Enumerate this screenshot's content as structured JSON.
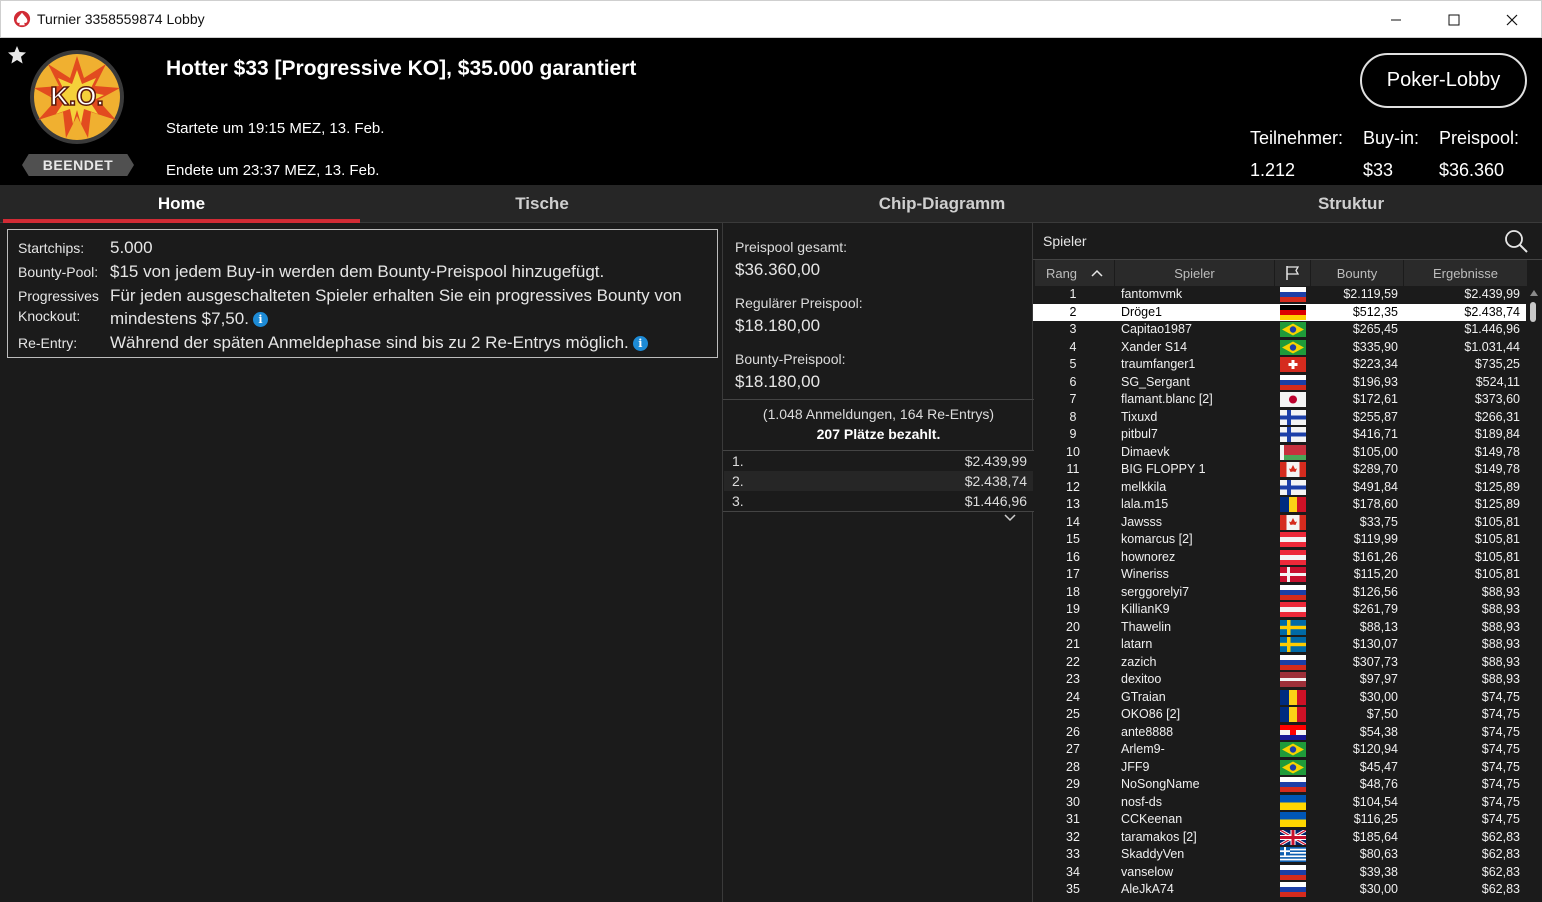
{
  "window": {
    "title": "Turnier 3358559874 Lobby"
  },
  "header": {
    "logo_text": "K.O.",
    "status": "BEENDET",
    "title": "Hotter $33 [Progressive KO], $35.000 garantiert",
    "started": "Startete um 19:15 MEZ, 13. Feb.",
    "ended": "Endete um 23:37 MEZ, 13. Feb.",
    "lobby_button": "Poker-Lobby",
    "stats": [
      {
        "label": "Teilnehmer:",
        "value": "1.212"
      },
      {
        "label": "Buy-in:",
        "value": "$33"
      },
      {
        "label": "Preispool:",
        "value": "$36.360"
      }
    ]
  },
  "tabs": [
    {
      "label": "Home",
      "active": true
    },
    {
      "label": "Tische",
      "active": false
    },
    {
      "label": "Chip-Diagramm",
      "active": false
    },
    {
      "label": "Struktur",
      "active": false
    }
  ],
  "info": {
    "startchips_label": "Startchips:",
    "startchips_value": "5.000",
    "bountypool_label": "Bounty-Pool:",
    "bountypool_value": "$15 von jedem Buy-in werden dem Bounty-Preispool hinzugefügt.",
    "progressive_label1": "Progressives",
    "progressive_label2": "Knockout:",
    "progressive_value1": "Für jeden ausgeschalteten Spieler erhalten Sie ein progressives Bounty von",
    "progressive_value2": "mindestens $7,50.",
    "reentry_label": "Re-Entry:",
    "reentry_value": "Während der späten Anmeldephase sind bis zu 2 Re-Entrys möglich.",
    "info_icon": "i"
  },
  "prizepool": {
    "total_label": "Preispool gesamt:",
    "total_value": "$36.360,00",
    "regular_label": "Regulärer Preispool:",
    "regular_value": "$18.180,00",
    "bounty_label": "Bounty-Preispool:",
    "bounty_value": "$18.180,00",
    "registrations": "(1.048 Anmeldungen, 164 Re-Entrys)",
    "paid": "207 Plätze bezahlt.",
    "places": [
      {
        "pos": "1.",
        "amount": "$2.439,99"
      },
      {
        "pos": "2.",
        "amount": "$2.438,74"
      },
      {
        "pos": "3.",
        "amount": "$1.446,96"
      }
    ]
  },
  "players": {
    "search_label": "Spieler",
    "columns": {
      "rank": "Rang",
      "player": "Spieler",
      "bounty": "Bounty",
      "result": "Ergebnisse"
    },
    "selected_index": 1,
    "rows": [
      {
        "rank": "1",
        "name": "fantomvmk",
        "flag": "ru",
        "bounty": "$2.119,59",
        "result": "$2.439,99"
      },
      {
        "rank": "2",
        "name": "Dröge1",
        "flag": "de",
        "bounty": "$512,35",
        "result": "$2.438,74"
      },
      {
        "rank": "3",
        "name": "Capitao1987",
        "flag": "br",
        "bounty": "$265,45",
        "result": "$1.446,96"
      },
      {
        "rank": "4",
        "name": "Xander S14",
        "flag": "br",
        "bounty": "$335,90",
        "result": "$1.031,44"
      },
      {
        "rank": "5",
        "name": "traumfanger1",
        "flag": "ch",
        "bounty": "$223,34",
        "result": "$735,25"
      },
      {
        "rank": "6",
        "name": "SG_Sergant",
        "flag": "ru",
        "bounty": "$196,93",
        "result": "$524,11"
      },
      {
        "rank": "7",
        "name": "flamant.blanc [2]",
        "flag": "jp",
        "bounty": "$172,61",
        "result": "$373,60"
      },
      {
        "rank": "8",
        "name": "Tixuxd",
        "flag": "fi",
        "bounty": "$255,87",
        "result": "$266,31"
      },
      {
        "rank": "9",
        "name": "pitbul7",
        "flag": "fi",
        "bounty": "$416,71",
        "result": "$189,84"
      },
      {
        "rank": "10",
        "name": "Dimaevk",
        "flag": "by",
        "bounty": "$105,00",
        "result": "$149,78"
      },
      {
        "rank": "11",
        "name": "BIG FLOPPY 1",
        "flag": "ca",
        "bounty": "$289,70",
        "result": "$149,78"
      },
      {
        "rank": "12",
        "name": "melkkila",
        "flag": "fi",
        "bounty": "$491,84",
        "result": "$125,89"
      },
      {
        "rank": "13",
        "name": "lala.m15",
        "flag": "ro",
        "bounty": "$178,60",
        "result": "$125,89"
      },
      {
        "rank": "14",
        "name": "Jawsss",
        "flag": "ca",
        "bounty": "$33,75",
        "result": "$105,81"
      },
      {
        "rank": "15",
        "name": "komarcus [2]",
        "flag": "at",
        "bounty": "$119,99",
        "result": "$105,81"
      },
      {
        "rank": "16",
        "name": "hownorez",
        "flag": "at",
        "bounty": "$161,26",
        "result": "$105,81"
      },
      {
        "rank": "17",
        "name": "Wineriss",
        "flag": "dk",
        "bounty": "$115,20",
        "result": "$105,81"
      },
      {
        "rank": "18",
        "name": "serggorelyi7",
        "flag": "ru",
        "bounty": "$126,56",
        "result": "$88,93"
      },
      {
        "rank": "19",
        "name": "KillianK9",
        "flag": "at",
        "bounty": "$261,79",
        "result": "$88,93"
      },
      {
        "rank": "20",
        "name": "Thawelin",
        "flag": "se",
        "bounty": "$88,13",
        "result": "$88,93"
      },
      {
        "rank": "21",
        "name": "latarn",
        "flag": "se",
        "bounty": "$130,07",
        "result": "$88,93"
      },
      {
        "rank": "22",
        "name": "zazich",
        "flag": "ru",
        "bounty": "$307,73",
        "result": "$88,93"
      },
      {
        "rank": "23",
        "name": "dexitoo",
        "flag": "lv",
        "bounty": "$97,97",
        "result": "$88,93"
      },
      {
        "rank": "24",
        "name": "GTraian",
        "flag": "ro",
        "bounty": "$30,00",
        "result": "$74,75"
      },
      {
        "rank": "25",
        "name": "OKO86 [2]",
        "flag": "ro",
        "bounty": "$7,50",
        "result": "$74,75"
      },
      {
        "rank": "26",
        "name": "ante8888",
        "flag": "hr",
        "bounty": "$54,38",
        "result": "$74,75"
      },
      {
        "rank": "27",
        "name": "Arlem9-",
        "flag": "br",
        "bounty": "$120,94",
        "result": "$74,75"
      },
      {
        "rank": "28",
        "name": "JFF9",
        "flag": "br",
        "bounty": "$45,47",
        "result": "$74,75"
      },
      {
        "rank": "29",
        "name": "NoSongName",
        "flag": "ru",
        "bounty": "$48,76",
        "result": "$74,75"
      },
      {
        "rank": "30",
        "name": "nosf-ds",
        "flag": "ua",
        "bounty": "$104,54",
        "result": "$74,75"
      },
      {
        "rank": "31",
        "name": "CCKeenan",
        "flag": "ua",
        "bounty": "$116,25",
        "result": "$74,75"
      },
      {
        "rank": "32",
        "name": "taramakos [2]",
        "flag": "gb",
        "bounty": "$185,64",
        "result": "$62,83"
      },
      {
        "rank": "33",
        "name": "SkaddyVen",
        "flag": "gr",
        "bounty": "$80,63",
        "result": "$62,83"
      },
      {
        "rank": "34",
        "name": "vanselow",
        "flag": "ru",
        "bounty": "$39,38",
        "result": "$62,83"
      },
      {
        "rank": "35",
        "name": "AleJkA74",
        "flag": "ru",
        "bounty": "$30,00",
        "result": "$62,83"
      }
    ]
  }
}
